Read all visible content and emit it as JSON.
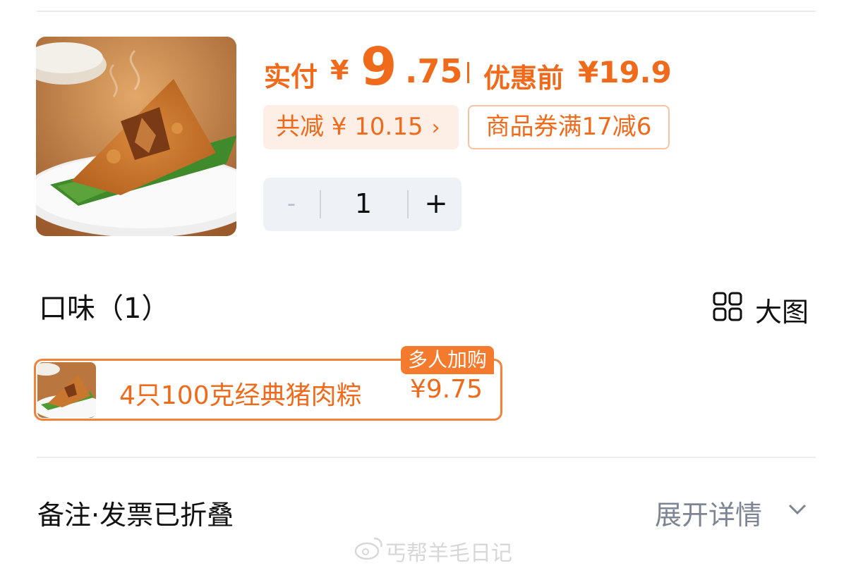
{
  "product": {
    "image_icon": "zongzi-product-image"
  },
  "price": {
    "paid_label": "实付",
    "currency": "¥",
    "amount_int": "9",
    "amount_dec": ".75",
    "original_label": "优惠前",
    "original_price": "¥19.9"
  },
  "discount": {
    "total_label": "共减 ¥ 10.15",
    "chevron": "›",
    "coupon_label": "商品券满17减6"
  },
  "quantity": {
    "minus": "-",
    "value": "1",
    "plus": "+"
  },
  "flavor": {
    "title": "口味（1）",
    "big_view_label": "大图",
    "big_view_icon": "grid-icon"
  },
  "option": {
    "badge": "多人加购",
    "name": "4只100克经典猪肉粽",
    "price": "¥9.75"
  },
  "footer": {
    "note_label": "备注·发票已折叠",
    "expand_label": "展开详情",
    "expand_icon": "chevron-down-icon"
  },
  "watermark": {
    "text": "丐帮羊毛日记"
  },
  "colors": {
    "accent": "#f06a1c",
    "accent_bg": "#fdeee6",
    "stepper_bg": "#eef1f6",
    "muted": "#7d8594"
  }
}
